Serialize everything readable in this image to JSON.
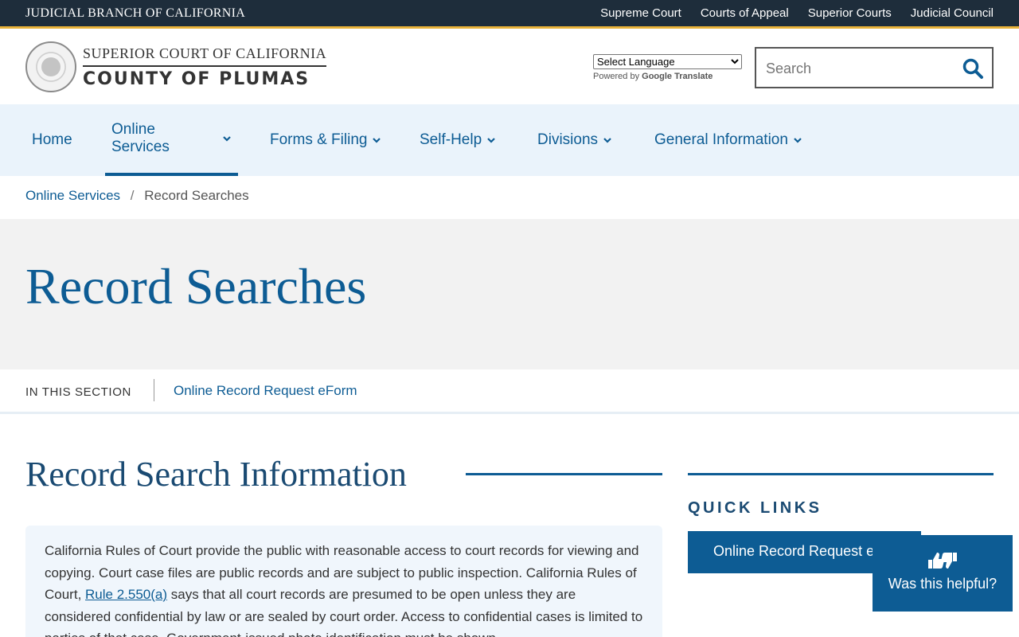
{
  "topbar": {
    "brand": "JUDICIAL BRANCH OF CALIFORNIA",
    "links": [
      "Supreme Court",
      "Courts of Appeal",
      "Superior Courts",
      "Judicial Council"
    ]
  },
  "header": {
    "court_line1": "SUPERIOR COURT OF CALIFORNIA",
    "court_line2": "COUNTY OF PLUMAS",
    "translate_label": "Select Language",
    "powered_by": "Powered by",
    "google": "Google",
    "translate_word": "Translate",
    "search_placeholder": "Search"
  },
  "nav": {
    "items": [
      {
        "label": "Home"
      },
      {
        "label": "Online Services"
      },
      {
        "label": "Forms & Filing"
      },
      {
        "label": "Self-Help"
      },
      {
        "label": "Divisions"
      },
      {
        "label": "General Information"
      }
    ]
  },
  "breadcrumb": {
    "parent": "Online Services",
    "separator": "/",
    "current": "Record Searches"
  },
  "hero": {
    "title": "Record Searches"
  },
  "section": {
    "label": "IN THIS SECTION",
    "link": "Online Record Request eForm"
  },
  "content": {
    "title": "Record Search Information",
    "p_before": "California Rules of Court provide the public with reasonable access to court records for viewing and copying. Court case files are public records and are subject to public inspection. California Rules of Court, ",
    "rule_link": "Rule 2.550(a)",
    "p_after": " says that all court records are presumed to be open unless they are considered confidential by law or are sealed by court order. Access to confidential cases is limited to parties of that case. Government-issued photo identification must be shown."
  },
  "sidebar": {
    "quick_links_title": "QUICK LINKS",
    "quick_link_1": "Online Record Request eForm"
  },
  "feedback": {
    "label": "Was this helpful?"
  },
  "colors": {
    "primary": "#0d5c94",
    "topbar": "#1e2d3b",
    "accent": "#e8b23a",
    "nav_bg": "#eaf3fb"
  }
}
